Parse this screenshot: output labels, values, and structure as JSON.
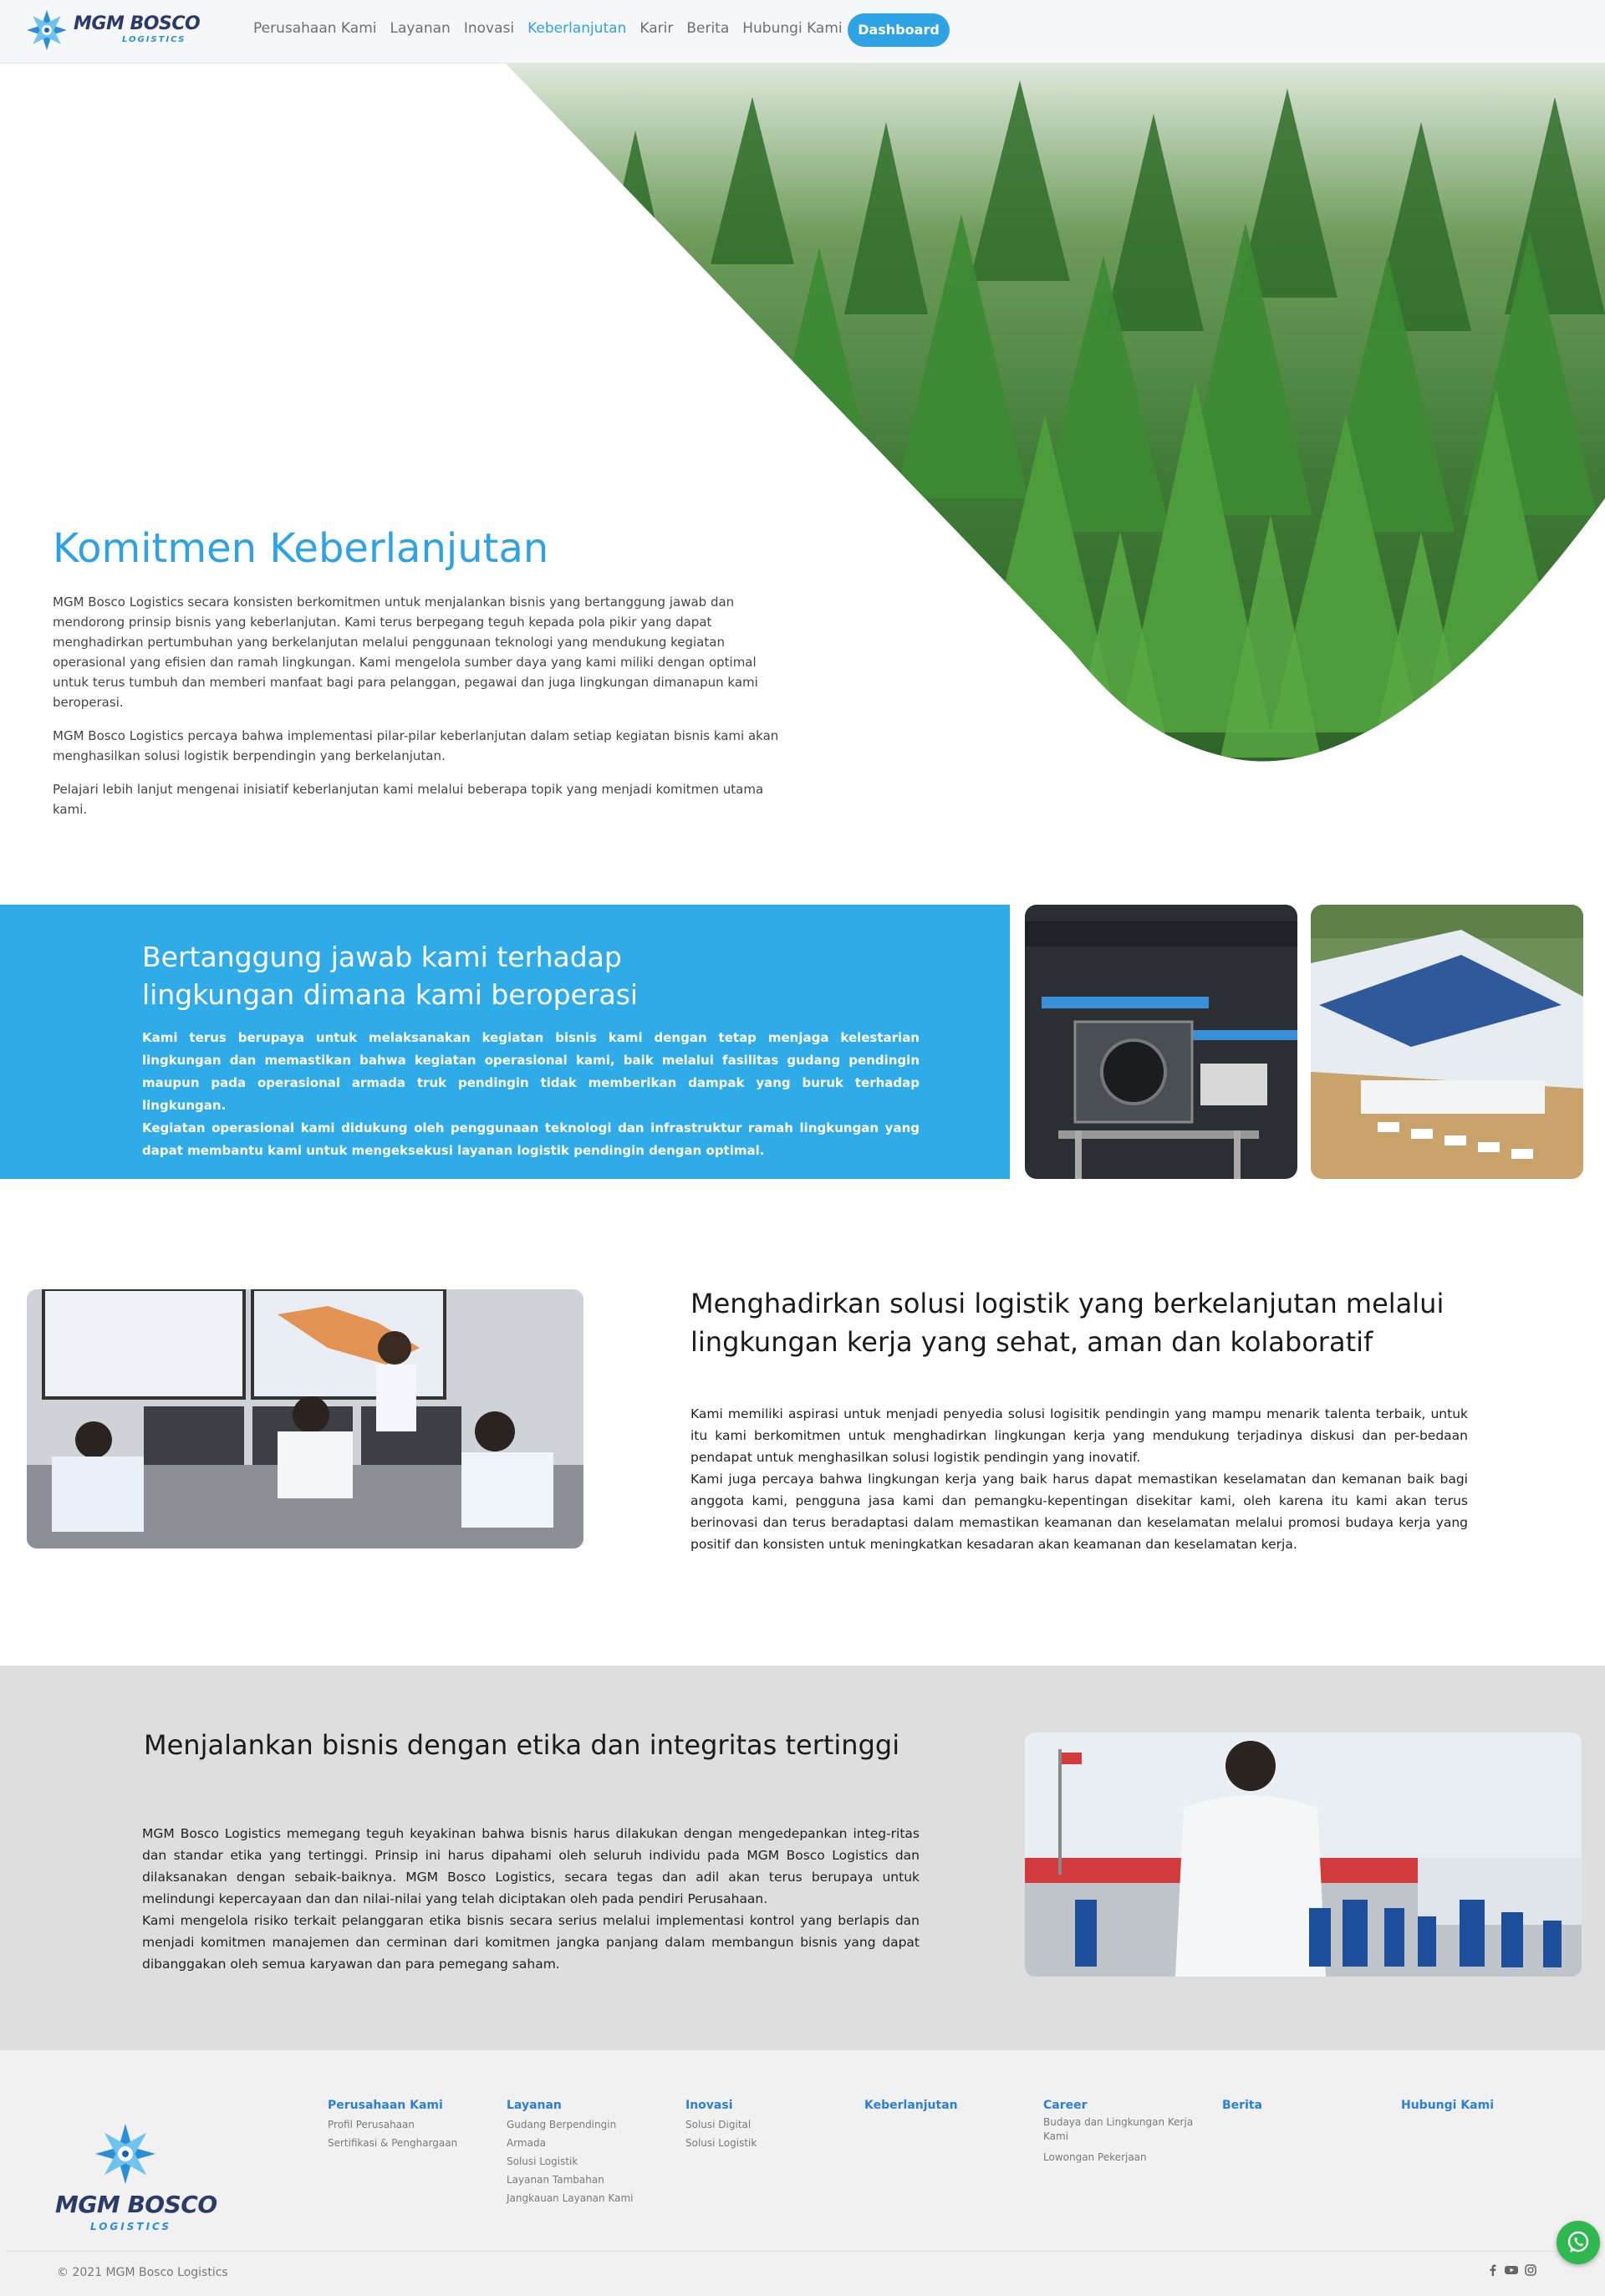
{
  "brand": {
    "name": "MGM BOSCO",
    "sub": "LOGISTICS",
    "accent": "#2ea3e3",
    "navy": "#2a3a6a"
  },
  "nav": {
    "items": [
      "Perusahaan Kami",
      "Layanan",
      "Inovasi",
      "Keberlanjutan",
      "Karir",
      "Berita",
      "Hubungi Kami"
    ],
    "active": "Keberlanjutan",
    "dashboard_label": "Dashboard"
  },
  "hero": {
    "title": "Komitmen Keberlanjutan",
    "paragraphs": [
      "MGM Bosco Logistics secara konsisten berkomitmen untuk menjalankan bisnis yang bertanggung jawab dan mendorong prinsip bisnis yang keberlanjutan. Kami terus berpegang teguh kepada pola pikir yang dapat menghadirkan pertumbuhan yang berkelanjutan melalui penggunaan teknologi yang mendukung kegiatan operasional yang efisien dan ramah lingkungan. Kami mengelola sumber daya yang kami miliki dengan optimal untuk terus tumbuh dan memberi manfaat bagi para pelanggan, pegawai dan juga lingkungan dimanapun kami beroperasi.",
      "MGM Bosco Logistics percaya bahwa implementasi pilar-pilar keberlanjutan dalam setiap kegiatan bisnis kami akan menghasilkan solusi logistik berpendingin yang berkelanjutan.",
      "Pelajari lebih lanjut mengenai inisiatif keberlanjutan kami melalui beberapa topik yang menjadi komitmen utama kami."
    ]
  },
  "environment": {
    "title": "Bertanggung jawab kami terhadap lingkungan dimana kami beroperasi",
    "text_lines": [
      "Kami terus berupaya untuk melaksanakan kegiatan bisnis kami dengan tetap menjaga kelestarian lingkungan dan memastikan bahwa kegiatan operasional kami, baik melalui fasilitas gudang pendingin maupun pada operasional armada truk pendingin tidak memberikan dampak yang buruk terhadap lingkungan.",
      "Kegiatan operasional kami didukung oleh penggunaan teknologi dan infrastruktur ramah lingkungan yang dapat membantu kami untuk mengeksekusi layanan logistik pendingin dengan optimal."
    ]
  },
  "workplace": {
    "title": "Menghadirkan solusi logistik yang berkelanjutan melalui lingkungan kerja yang sehat, aman dan kolaboratif",
    "text_lines": [
      "Kami memiliki aspirasi untuk menjadi penyedia solusi logisitik pendingin yang mampu menarik talenta terbaik, untuk itu kami berkomitmen untuk menghadirkan lingkungan kerja yang mendukung terjadinya diskusi dan per-bedaan pendapat untuk menghasilkan solusi logistik pendingin yang inovatif.",
      "Kami juga percaya bahwa lingkungan kerja yang baik harus dapat memastikan keselamatan dan kemanan baik bagi anggota kami, pengguna jasa kami dan pemangku-kepentingan disekitar kami, oleh karena itu kami akan terus berinovasi dan terus beradaptasi dalam memastikan keamanan dan keselamatan melalui promosi budaya kerja yang positif dan konsisten untuk meningkatkan kesadaran akan keamanan dan keselamatan kerja."
    ]
  },
  "ethics": {
    "title": "Menjalankan bisnis dengan etika dan integritas tertinggi",
    "text_lines": [
      "MGM Bosco Logistics memegang teguh keyakinan bahwa bisnis harus dilakukan dengan mengedepankan integ-ritas dan standar etika yang tertinggi. Prinsip ini harus dipahami oleh seluruh individu pada MGM Bosco Logistics dan dilaksanakan dengan sebaik-baiknya. MGM Bosco Logistics, secara tegas dan adil akan terus berupaya untuk melindungi kepercayaan dan dan nilai-nilai yang telah diciptakan oleh pada pendiri Perusahaan.",
      "Kami mengelola risiko terkait pelanggaran etika bisnis secara serius melalui implementasi kontrol yang berlapis dan menjadi komitmen manajemen dan cerminan dari komitmen jangka panjang dalam membangun bisnis yang dapat dibanggakan oleh semua karyawan dan para pemegang saham."
    ]
  },
  "footer": {
    "columns": [
      {
        "heading": "Perusahaan Kami",
        "items": [
          "Profil Perusahaan",
          "Sertifikasi & Penghargaan"
        ]
      },
      {
        "heading": "Layanan",
        "items": [
          "Gudang Berpendingin",
          "Armada",
          "Solusi Logistik",
          "Layanan Tambahan",
          "Jangkauan Layanan Kami"
        ]
      },
      {
        "heading": "Inovasi",
        "items": [
          "Solusi Digital",
          "Solusi Logistik"
        ]
      },
      {
        "heading": "Keberlanjutan",
        "items": []
      },
      {
        "heading": "Career",
        "items": [
          "Budaya dan Lingkungan Kerja Kami",
          "Lowongan Pekerjaan"
        ]
      },
      {
        "heading": "Berita",
        "items": []
      },
      {
        "heading": "Hubungi Kami",
        "items": []
      }
    ],
    "copyright": "© 2021 MGM Bosco Logistics",
    "social_icons": [
      "facebook-icon",
      "youtube-icon",
      "instagram-icon"
    ]
  }
}
